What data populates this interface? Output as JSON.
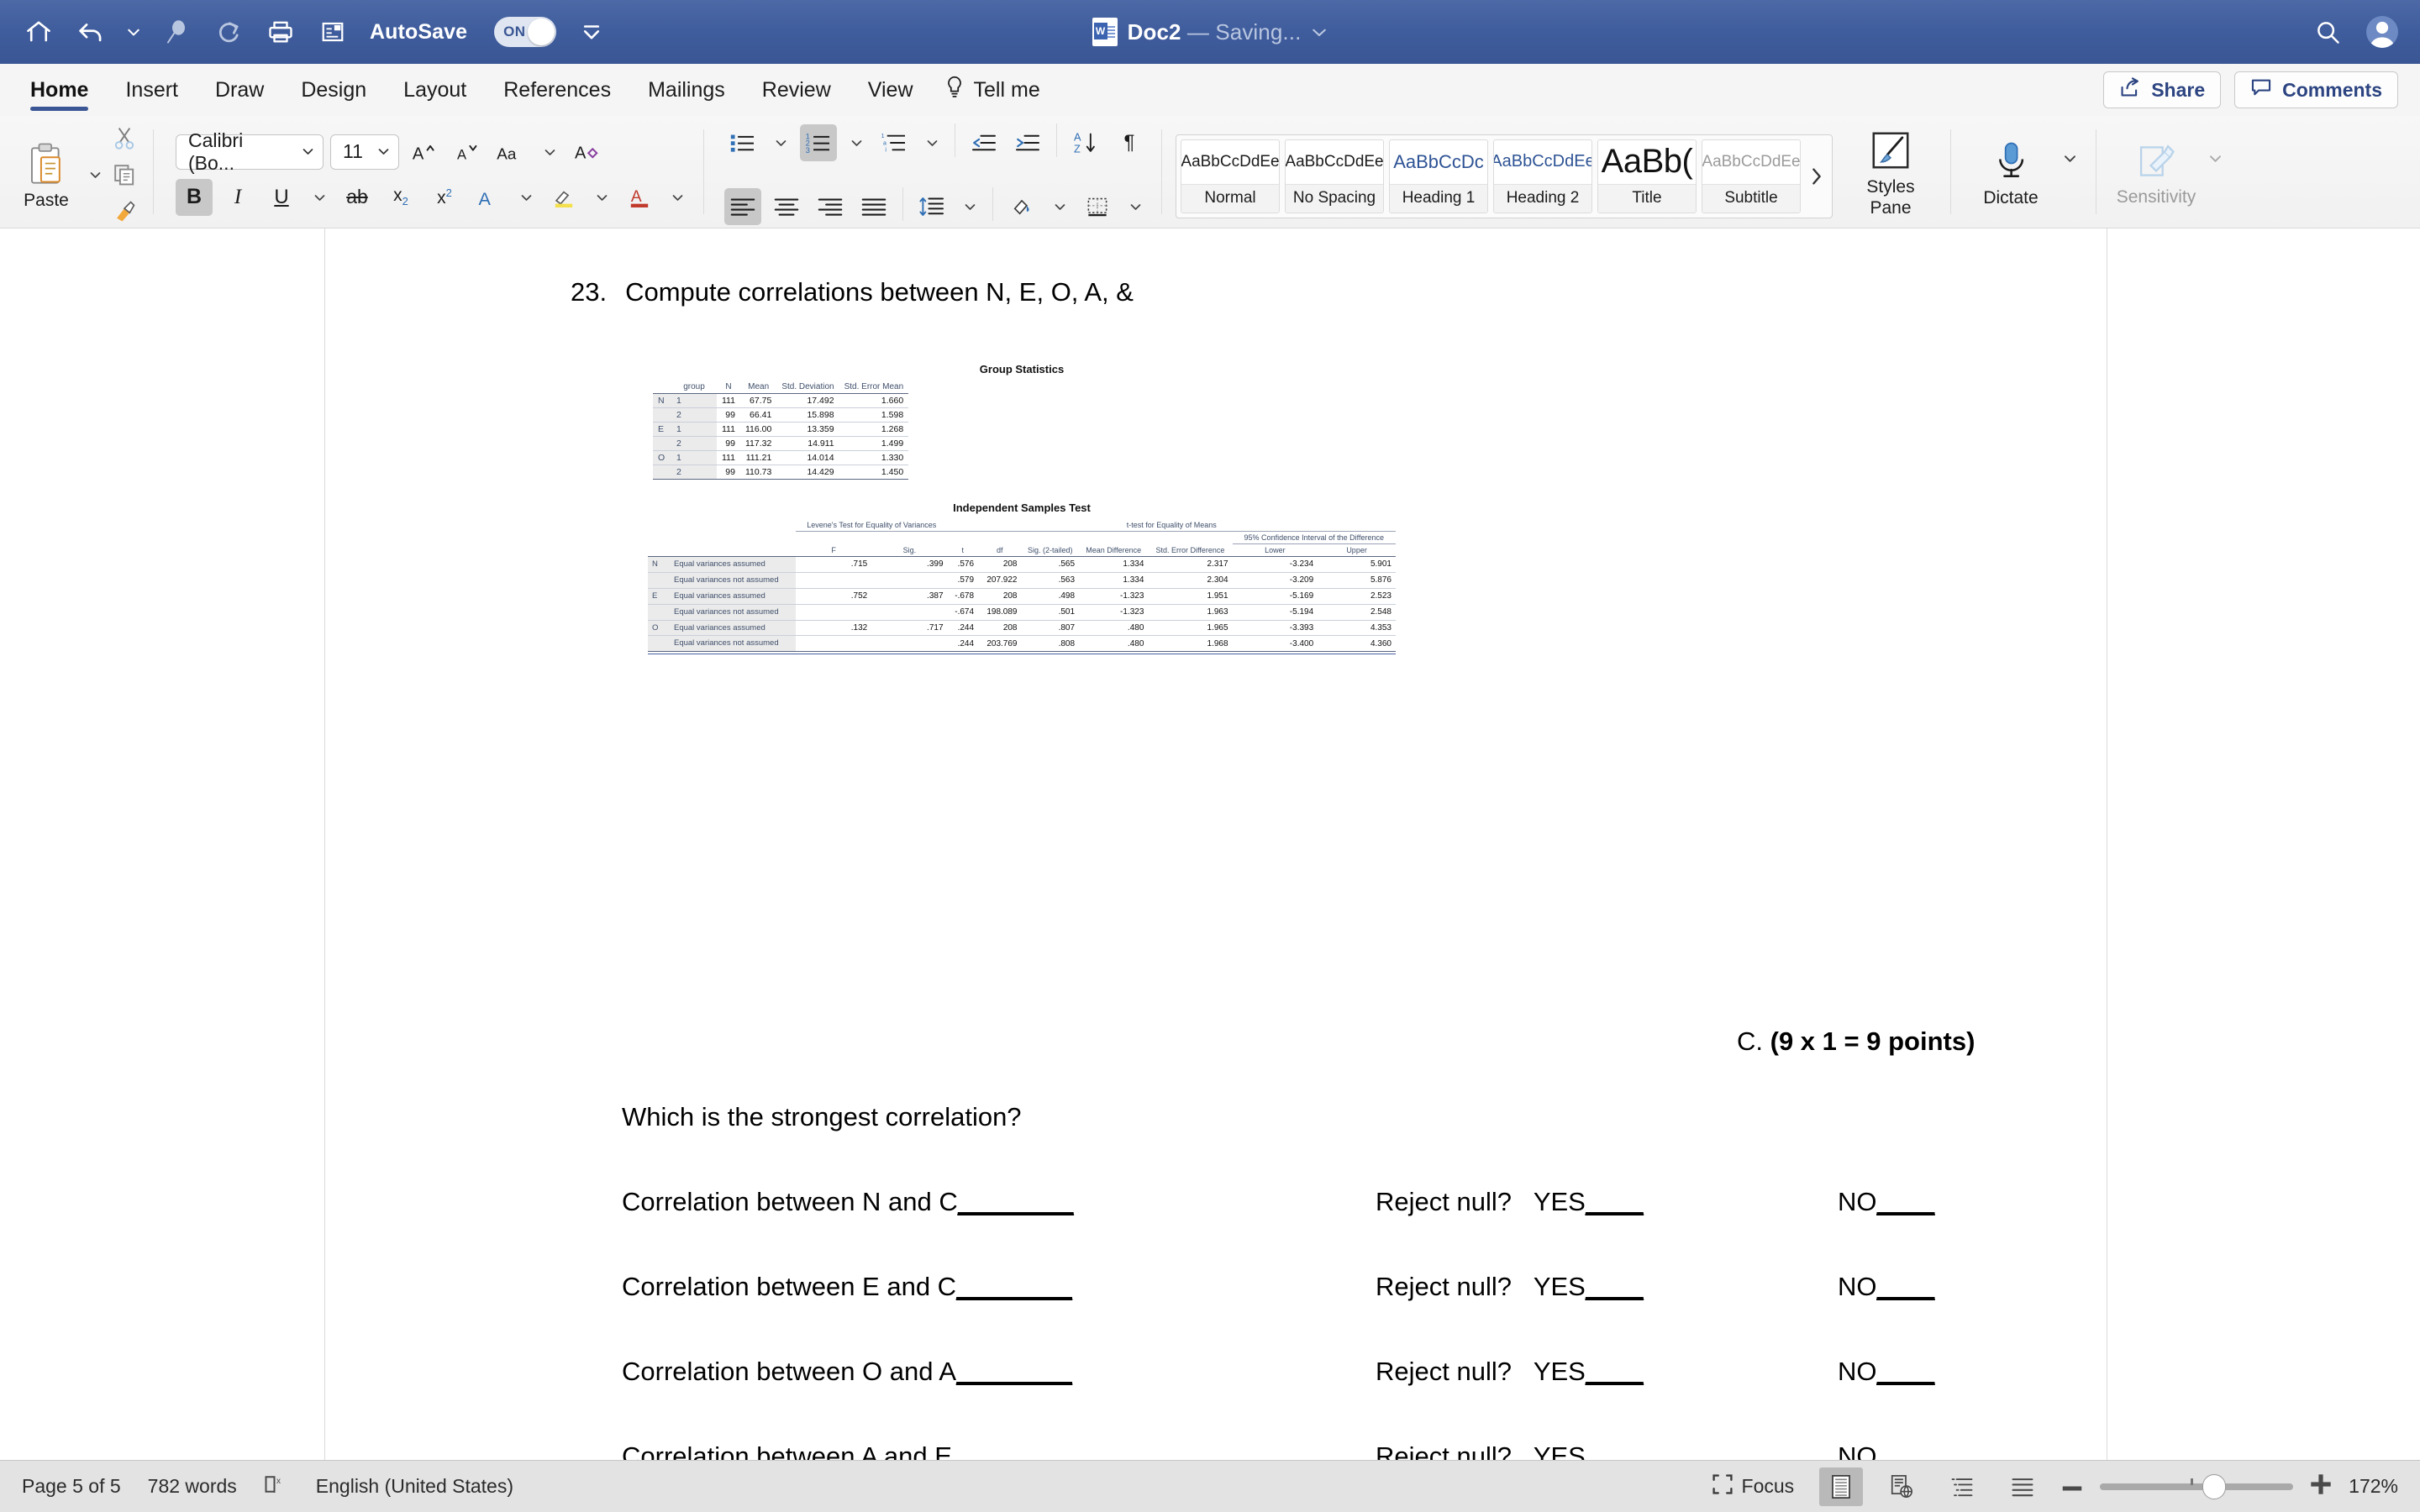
{
  "titlebar": {
    "autosave_label": "AutoSave",
    "autosave_state": "ON",
    "doc_name": "Doc2",
    "doc_state": "— Saving...",
    "icons": [
      "home-icon",
      "undo-icon",
      "undo-dropdown-icon",
      "customize-icon",
      "redo-icon",
      "print-icon",
      "print-preview-icon",
      "toolbar-overflow-icon",
      "search-icon",
      "account-avatar"
    ]
  },
  "tabs": {
    "items": [
      {
        "label": "Home",
        "active": true
      },
      {
        "label": "Insert",
        "active": false
      },
      {
        "label": "Draw",
        "active": false
      },
      {
        "label": "Design",
        "active": false
      },
      {
        "label": "Layout",
        "active": false
      },
      {
        "label": "References",
        "active": false
      },
      {
        "label": "Mailings",
        "active": false
      },
      {
        "label": "Review",
        "active": false
      },
      {
        "label": "View",
        "active": false
      }
    ],
    "tell_me": "Tell me",
    "share": "Share",
    "comments": "Comments"
  },
  "ribbon": {
    "paste_label": "Paste",
    "font_name": "Calibri (Bo...",
    "font_size": "11",
    "styles": [
      {
        "preview": "AaBbCcDdEe",
        "name": "Normal"
      },
      {
        "preview": "AaBbCcDdEe",
        "name": "No Spacing"
      },
      {
        "preview": "AaBbCcDc",
        "name": "Heading 1"
      },
      {
        "preview": "AaBbCcDdEe",
        "name": "Heading 2"
      },
      {
        "preview": "AaBb(",
        "name": "Title"
      },
      {
        "preview": "AaBbCcDdEe",
        "name": "Subtitle"
      }
    ],
    "styles_pane": "Styles\nPane",
    "styles_pane_line1": "Styles",
    "styles_pane_line2": "Pane",
    "dictate": "Dictate",
    "sensitivity": "Sensitivity"
  },
  "document": {
    "question_number": "23.",
    "question_text": "Compute correlations between N, E, O, A, &",
    "points_prefix": "C. ",
    "points_bold": "(9 x 1 = 9 points)",
    "prompt": "Which is the strongest correlation?",
    "rows": [
      {
        "label": "Correlation between N and C",
        "blank": "________",
        "reject": "Reject null?",
        "yes": "YES",
        "yes_blank": "____",
        "no": "NO",
        "no_blank": "____"
      },
      {
        "label": "Correlation between E and C",
        "blank": "________",
        "reject": "Reject null?",
        "yes": "YES",
        "yes_blank": "____",
        "no": "NO",
        "no_blank": "____"
      },
      {
        "label": "Correlation between O and A",
        "blank": "________",
        "reject": "Reject null?",
        "yes": "YES",
        "yes_blank": "____",
        "no": "NO",
        "no_blank": "____"
      },
      {
        "label": "Correlation between A and E",
        "blank": "________",
        "reject": "Reject null?",
        "yes": "YES",
        "yes_blank": "____",
        "no": "NO",
        "no_blank": "____"
      }
    ]
  },
  "spss": {
    "group_statistics": {
      "title": "Group Statistics",
      "columns": [
        "group",
        "N",
        "Mean",
        "Std. Deviation",
        "Std. Error Mean"
      ],
      "rows": [
        {
          "var": "N",
          "group": "1",
          "n": "111",
          "mean": "67.75",
          "sd": "17.492",
          "sem": "1.660"
        },
        {
          "var": "",
          "group": "2",
          "n": "99",
          "mean": "66.41",
          "sd": "15.898",
          "sem": "1.598"
        },
        {
          "var": "E",
          "group": "1",
          "n": "111",
          "mean": "116.00",
          "sd": "13.359",
          "sem": "1.268"
        },
        {
          "var": "",
          "group": "2",
          "n": "99",
          "mean": "117.32",
          "sd": "14.911",
          "sem": "1.499"
        },
        {
          "var": "O",
          "group": "1",
          "n": "111",
          "mean": "111.21",
          "sd": "14.014",
          "sem": "1.330"
        },
        {
          "var": "",
          "group": "2",
          "n": "99",
          "mean": "110.73",
          "sd": "14.429",
          "sem": "1.450"
        }
      ]
    },
    "independent_samples_test": {
      "title": "Independent Samples Test",
      "span_levene": "Levene's Test for Equality of Variances",
      "span_ttest": "t-test for Equality of Means",
      "span_ci": "95% Confidence Interval of the Difference",
      "columns": [
        "F",
        "Sig.",
        "t",
        "df",
        "Sig. (2-tailed)",
        "Mean Difference",
        "Std. Error Difference",
        "Lower",
        "Upper"
      ],
      "rows": [
        {
          "var": "N",
          "assumption": "Equal variances assumed",
          "F": ".715",
          "Sig": ".399",
          "t": ".576",
          "df": "208",
          "sig2": ".565",
          "meandiff": "1.334",
          "sediff": "2.317",
          "lower": "-3.234",
          "upper": "5.901"
        },
        {
          "var": "",
          "assumption": "Equal variances not assumed",
          "F": "",
          "Sig": "",
          "t": ".579",
          "df": "207.922",
          "sig2": ".563",
          "meandiff": "1.334",
          "sediff": "2.304",
          "lower": "-3.209",
          "upper": "5.876"
        },
        {
          "var": "E",
          "assumption": "Equal variances assumed",
          "F": ".752",
          "Sig": ".387",
          "t": "-.678",
          "df": "208",
          "sig2": ".498",
          "meandiff": "-1.323",
          "sediff": "1.951",
          "lower": "-5.169",
          "upper": "2.523"
        },
        {
          "var": "",
          "assumption": "Equal variances not assumed",
          "F": "",
          "Sig": "",
          "t": "-.674",
          "df": "198.089",
          "sig2": ".501",
          "meandiff": "-1.323",
          "sediff": "1.963",
          "lower": "-5.194",
          "upper": "2.548"
        },
        {
          "var": "O",
          "assumption": "Equal variances assumed",
          "F": ".132",
          "Sig": ".717",
          "t": ".244",
          "df": "208",
          "sig2": ".807",
          "meandiff": ".480",
          "sediff": "1.965",
          "lower": "-3.393",
          "upper": "4.353"
        },
        {
          "var": "",
          "assumption": "Equal variances not assumed",
          "F": "",
          "Sig": "",
          "t": ".244",
          "df": "203.769",
          "sig2": ".808",
          "meandiff": ".480",
          "sediff": "1.968",
          "lower": "-3.400",
          "upper": "4.360"
        }
      ]
    }
  },
  "statusbar": {
    "page": "Page 5 of 5",
    "words": "782 words",
    "language": "English (United States)",
    "focus": "Focus",
    "zoom": "172%"
  },
  "colors": {
    "titlebar": "#3f5c9c",
    "accent": "#3a5694",
    "link": "#2c4481",
    "heading_style": "#2e5395"
  }
}
